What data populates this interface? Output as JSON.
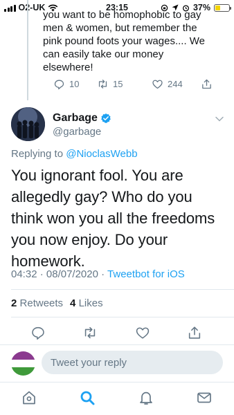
{
  "status_bar": {
    "carrier": "O2-UK",
    "time": "23:15",
    "battery_percent": "37%",
    "battery_level": 0.37,
    "icons": [
      "signal-icon",
      "wifi-icon",
      "location-icon",
      "alarm-icon",
      "battery-icon"
    ]
  },
  "parent_tweet": {
    "text_lines": [
      "you want to be homophobic to gay",
      "men & women, but remember the",
      "pink pound foots your wages.... We",
      "can easily take our money",
      "elsewhere!"
    ],
    "replies": "10",
    "retweets": "15",
    "likes": "244"
  },
  "tweet": {
    "author_name": "Garbage",
    "author_handle": "@garbage",
    "replying_prefix": "Replying to",
    "replying_to": "@NioclasWebb",
    "text": "You ignorant fool. You are allegedly gay? Who do you think won you all the freedoms you now enjoy. Do your homework.",
    "time": "04:32",
    "date": "08/07/2020",
    "separator": "·",
    "via": "Tweetbot for iOS",
    "retweets_count": "2",
    "retweets_label": "Retweets",
    "likes_count": "4",
    "likes_label": "Likes"
  },
  "reply_bar": {
    "placeholder": "Tweet your reply",
    "avatar_colors": [
      "#8b3a8f",
      "#ffffff",
      "#3f9a3a"
    ]
  },
  "tabbar": {
    "items": [
      "home-icon",
      "search-icon",
      "notifications-icon",
      "messages-icon"
    ],
    "active": "search-icon"
  },
  "colors": {
    "accent": "#1da1f2",
    "secondary_text": "#657786",
    "primary_text": "#14171a",
    "divider": "#e1e8ed"
  }
}
